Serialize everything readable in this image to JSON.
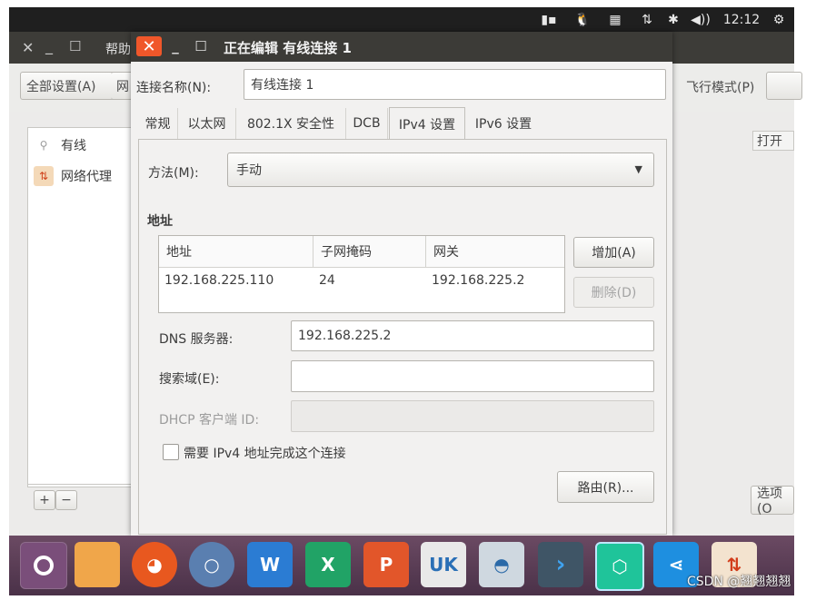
{
  "topbar": {
    "time": "12:12",
    "icons": [
      "keyboard-icon",
      "tux-icon",
      "calendar-icon",
      "network-arrows-icon",
      "bluetooth-icon",
      "volume-icon",
      "gear-icon"
    ]
  },
  "bg_window": {
    "menu_help": "帮助",
    "all_settings_button": "全部设置(A)",
    "network_cut": "网",
    "airplane_mode_label": "飞行模式(P)",
    "open_label": "打开",
    "options_button": "选项(O",
    "sidebar": {
      "items": [
        {
          "label": "有线",
          "icon": "wired-icon"
        },
        {
          "label": "网络代理",
          "icon": "proxy-icon"
        }
      ],
      "add_label": "+",
      "remove_label": "−"
    }
  },
  "dialog": {
    "title": "正在编辑 有线连接 1",
    "close_glyph": "✕",
    "min_glyph": "_",
    "max_glyph": "☐",
    "connection_name_label": "连接名称(N):",
    "connection_name_value": "有线连接 1",
    "tabs": [
      {
        "label": "常规",
        "active": false
      },
      {
        "label": "以太网",
        "active": false
      },
      {
        "label": "802.1X 安全性",
        "active": false
      },
      {
        "label": "DCB",
        "active": false
      },
      {
        "label": "IPv4 设置",
        "active": true
      },
      {
        "label": "IPv6 设置",
        "active": false
      }
    ],
    "method_label": "方法(M):",
    "method_value": "手动",
    "address_section": "地址",
    "address_table": {
      "headers": [
        "地址",
        "子网掩码",
        "网关"
      ],
      "rows": [
        [
          "192.168.225.110",
          "24",
          "192.168.225.2"
        ]
      ]
    },
    "add_button": "增加(A)",
    "delete_button": "删除(D)",
    "dns_label": "DNS 服务器:",
    "dns_value": "192.168.225.2",
    "search_domain_label": "搜索域(E):",
    "search_domain_value": "",
    "dhcp_client_id_label": "DHCP 客户端 ID:",
    "dhcp_client_id_value": "",
    "require_ipv4_label": "需要 IPv4 地址完成这个连接",
    "require_ipv4_checked": false,
    "routes_button": "路由(R)..."
  },
  "dock": {
    "icons": [
      "ubuntu-icon",
      "folder-icon",
      "firefox-icon",
      "browser-icon",
      "word-icon",
      "excel-icon",
      "powerpoint-icon",
      "uk-icon",
      "installer-icon",
      "terminal-icon",
      "gateway-icon",
      "share-icon",
      "updates-icon"
    ]
  },
  "watermark": "CSDN @翘翘翘翘"
}
